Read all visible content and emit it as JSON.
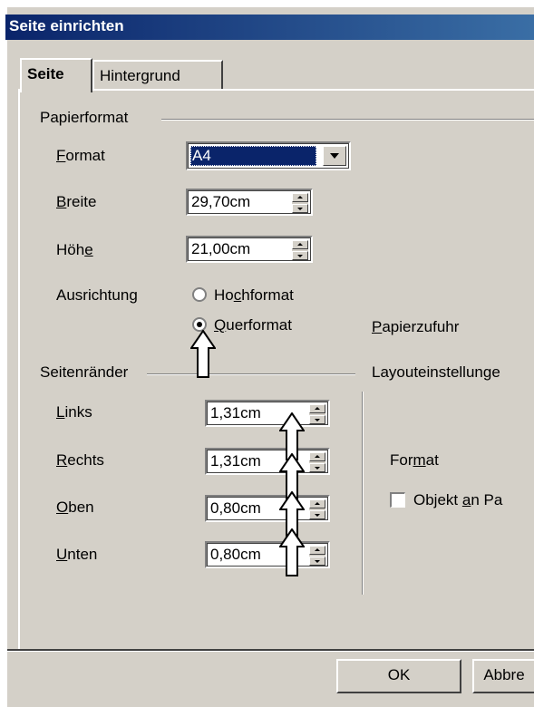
{
  "window": {
    "title": "Seite einrichten"
  },
  "tabs": [
    {
      "label": "Seite",
      "active": true
    },
    {
      "label": "Hintergrund",
      "active": false
    }
  ],
  "papierformat": {
    "group_label": "Papierformat",
    "format": {
      "label": "Format",
      "value": "A4"
    },
    "breite": {
      "label": "Breite",
      "value": "29,70cm"
    },
    "hoehe": {
      "label": "Höhe",
      "value": "21,00cm"
    },
    "ausrichtung": {
      "label": "Ausrichtung",
      "options": [
        {
          "label": "Hochformat",
          "checked": false
        },
        {
          "label": "Querformat",
          "checked": true
        }
      ]
    },
    "papierzufuhr_label": "Papierzufuhr"
  },
  "seitenraender": {
    "group_label": "Seitenränder",
    "links": {
      "label": "Links",
      "value": "1,31cm"
    },
    "rechts": {
      "label": "Rechts",
      "value": "1,31cm"
    },
    "oben": {
      "label": "Oben",
      "value": "0,80cm"
    },
    "unten": {
      "label": "Unten",
      "value": "0,80cm"
    }
  },
  "layout": {
    "group_label": "Layouteinstellunge",
    "format_label": "Format",
    "checkbox_label": "Objekt an Pa",
    "checkbox_checked": false
  },
  "buttons": {
    "ok": "OK",
    "cancel": "Abbre"
  },
  "colors": {
    "face": "#d4d0c8",
    "title_start": "#0a246a",
    "title_end": "#3a6ea5",
    "selection": "#0a246a"
  }
}
